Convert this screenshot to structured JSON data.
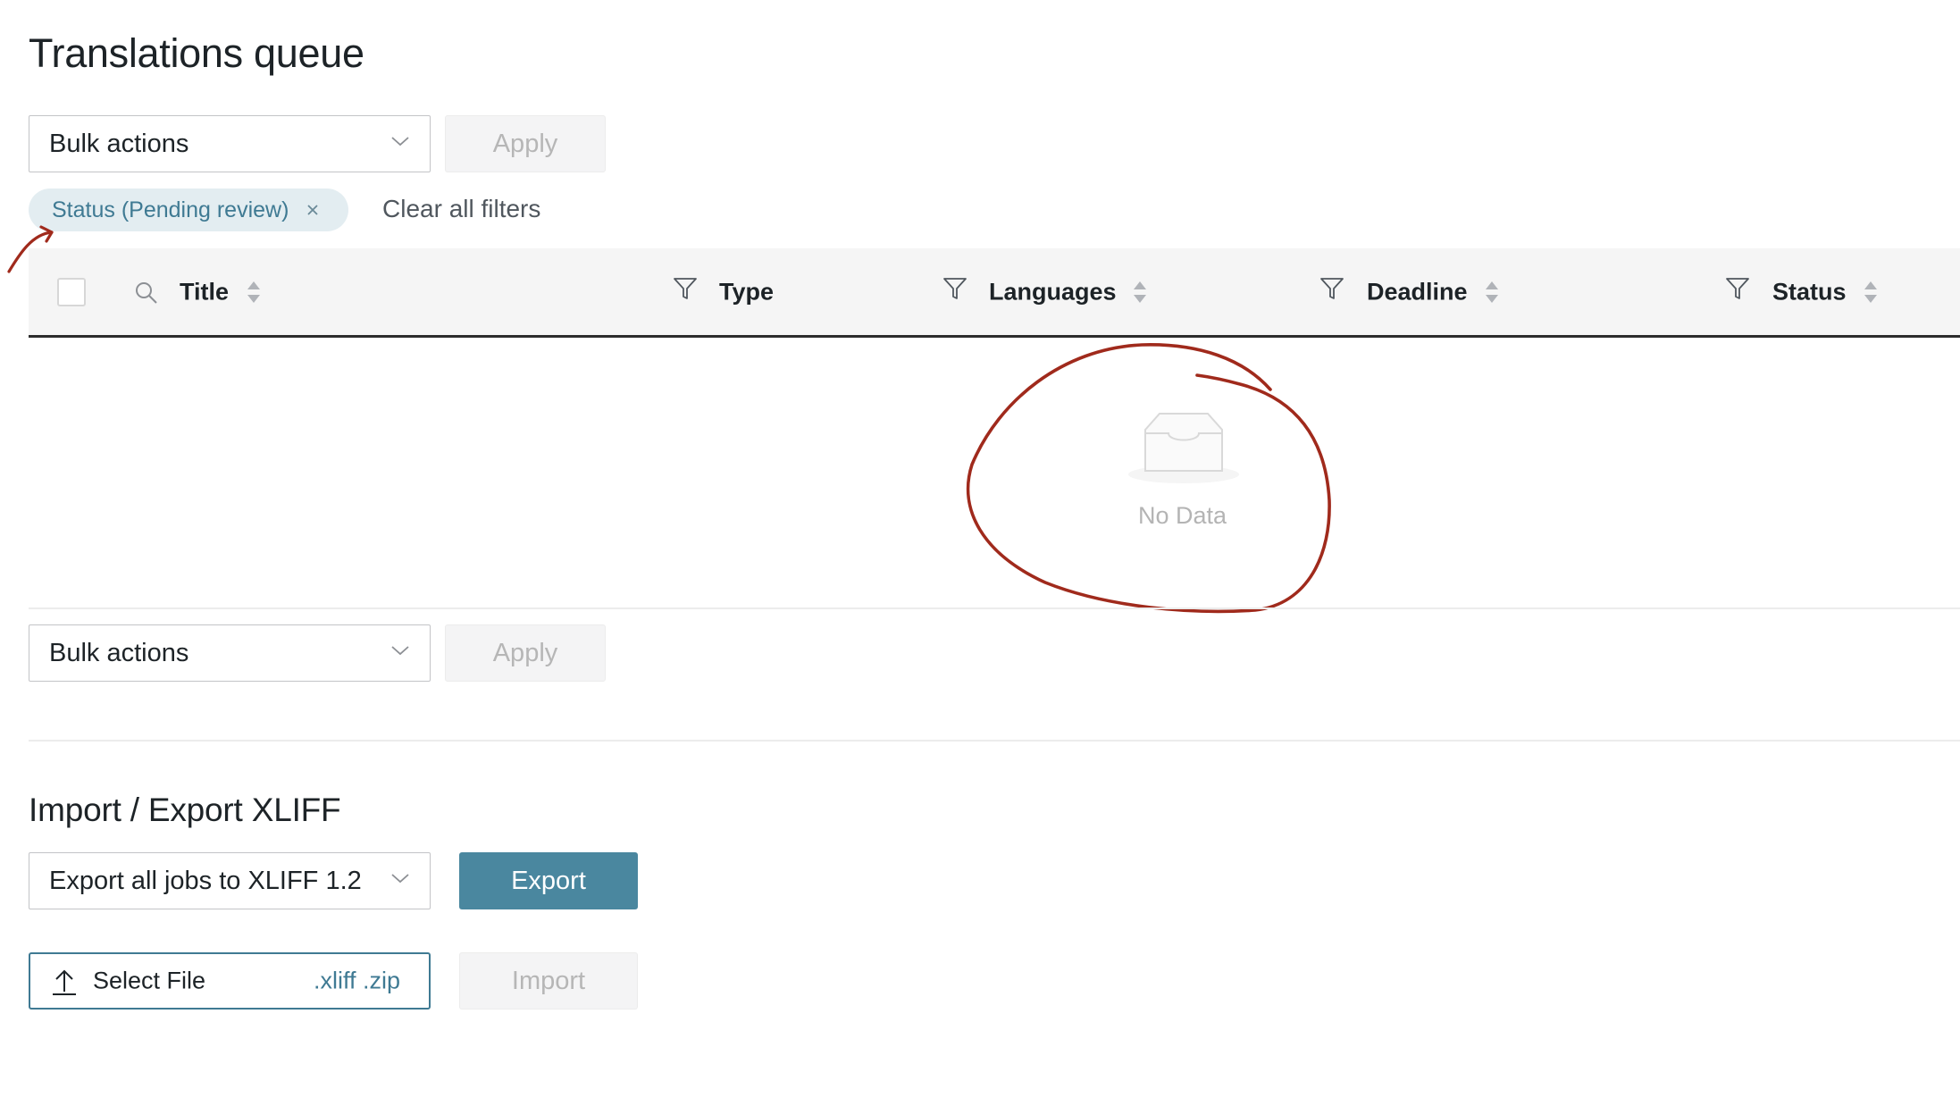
{
  "page": {
    "title": "Translations queue"
  },
  "bulk_top": {
    "select_value": "Bulk actions",
    "apply_label": "Apply"
  },
  "filters": {
    "chip_label": "Status (Pending review)",
    "clear_label": "Clear all filters"
  },
  "table": {
    "columns": [
      {
        "label": "Title",
        "sortable": true,
        "filter": false,
        "search": true
      },
      {
        "label": "Type",
        "sortable": false,
        "filter": true
      },
      {
        "label": "Languages",
        "sortable": true,
        "filter": true
      },
      {
        "label": "Deadline",
        "sortable": true,
        "filter": true
      },
      {
        "label": "Status",
        "sortable": true,
        "filter": true
      }
    ],
    "empty_text": "No Data"
  },
  "bulk_bottom": {
    "select_value": "Bulk actions",
    "apply_label": "Apply"
  },
  "xliff": {
    "title": "Import / Export XLIFF",
    "export_select_value": "Export all jobs to XLIFF 1.2",
    "export_label": "Export",
    "select_file_label": "Select File",
    "file_types": ".xliff .zip",
    "import_label": "Import"
  },
  "colors": {
    "primary": "#4a879f",
    "chip_bg": "#e3edf1",
    "annotation": "#a02a1c"
  }
}
